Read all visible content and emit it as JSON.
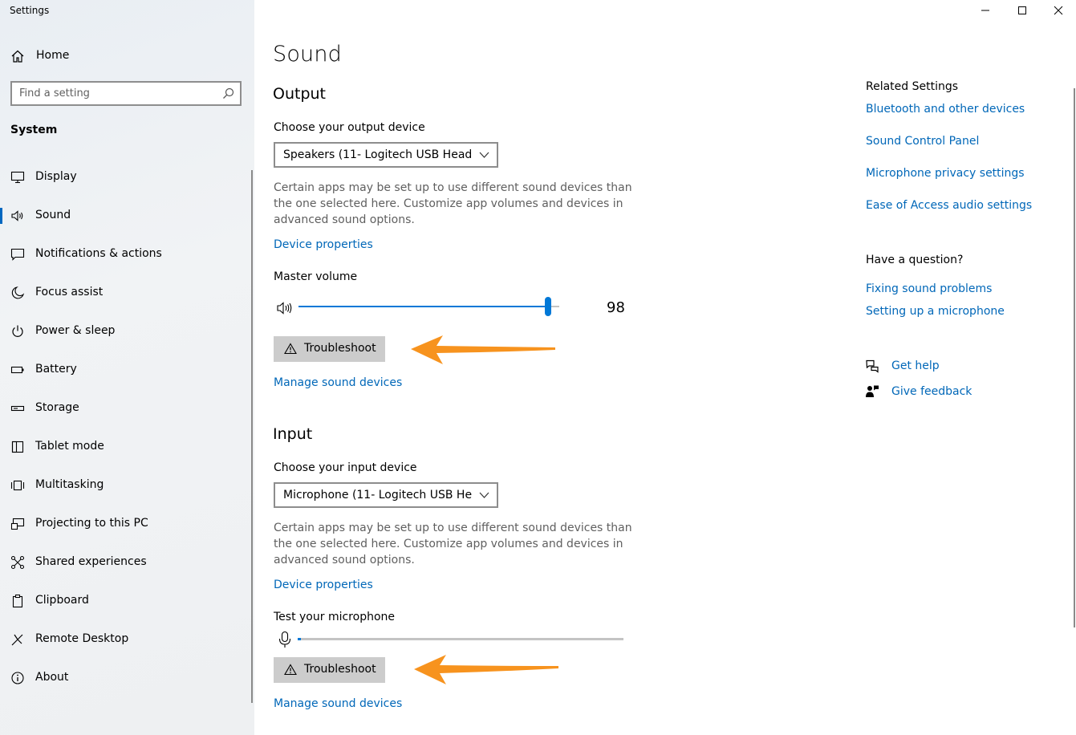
{
  "window": {
    "title": "Settings"
  },
  "sidebar": {
    "home_label": "Home",
    "search_placeholder": "Find a setting",
    "section_title": "System",
    "items": [
      {
        "label": "Display",
        "icon": "monitor-icon"
      },
      {
        "label": "Sound",
        "icon": "speaker-icon",
        "active": true
      },
      {
        "label": "Notifications & actions",
        "icon": "message-icon"
      },
      {
        "label": "Focus assist",
        "icon": "moon-icon"
      },
      {
        "label": "Power & sleep",
        "icon": "power-icon"
      },
      {
        "label": "Battery",
        "icon": "battery-icon"
      },
      {
        "label": "Storage",
        "icon": "storage-icon"
      },
      {
        "label": "Tablet mode",
        "icon": "tablet-icon"
      },
      {
        "label": "Multitasking",
        "icon": "multitasking-icon"
      },
      {
        "label": "Projecting to this PC",
        "icon": "projecting-icon"
      },
      {
        "label": "Shared experiences",
        "icon": "shared-icon"
      },
      {
        "label": "Clipboard",
        "icon": "clipboard-icon"
      },
      {
        "label": "Remote Desktop",
        "icon": "remote-desktop-icon"
      },
      {
        "label": "About",
        "icon": "info-icon"
      }
    ]
  },
  "main": {
    "title": "Sound",
    "output": {
      "heading": "Output",
      "device_label": "Choose your output device",
      "device_value": "Speakers (11- Logitech USB Heads...",
      "description": "Certain apps may be set up to use different sound devices than the one selected here. Customize app volumes and devices in advanced sound options.",
      "device_properties": "Device properties",
      "master_volume_label": "Master volume",
      "volume": 98,
      "volume_text": "98",
      "troubleshoot": "Troubleshoot",
      "manage": "Manage sound devices"
    },
    "input": {
      "heading": "Input",
      "device_label": "Choose your input device",
      "device_value": "Microphone (11- Logitech USB He...",
      "description": "Certain apps may be set up to use different sound devices than the one selected here. Customize app volumes and devices in advanced sound options.",
      "device_properties": "Device properties",
      "test_label": "Test your microphone",
      "mic_level": 1,
      "troubleshoot": "Troubleshoot",
      "manage": "Manage sound devices"
    }
  },
  "related": {
    "heading": "Related Settings",
    "links": [
      "Bluetooth and other devices",
      "Sound Control Panel",
      "Microphone privacy settings",
      "Ease of Access audio settings"
    ],
    "question_heading": "Have a question?",
    "question_links": [
      "Fixing sound problems",
      "Setting up a microphone"
    ],
    "get_help": "Get help",
    "give_feedback": "Give feedback"
  },
  "colors": {
    "accent": "#0067b8",
    "slider": "#0078d7",
    "annotation_arrow": "#f7931e"
  }
}
